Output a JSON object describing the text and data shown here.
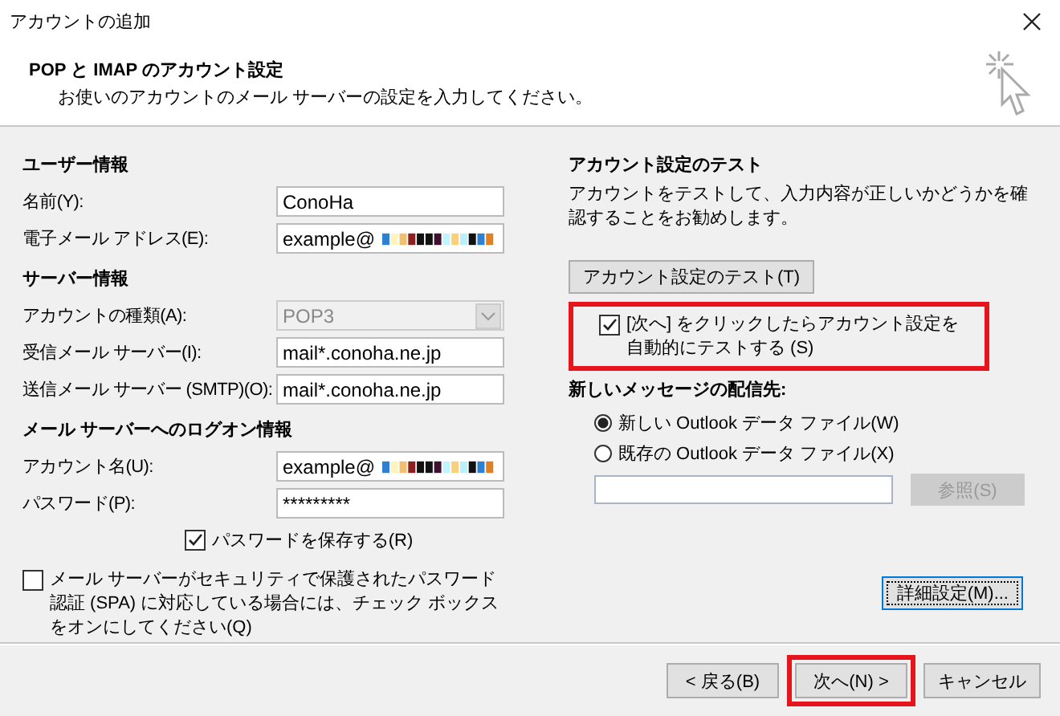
{
  "window": {
    "title": "アカウントの追加"
  },
  "header": {
    "title": "POP と IMAP のアカウント設定",
    "subtitle": "お使いのアカウントのメール サーバーの設定を入力してください。"
  },
  "sections": [
    {
      "heading": "ユーザー情報",
      "fields": [
        {
          "label": "名前(Y):",
          "kind": "text",
          "value": "ConoHa"
        },
        {
          "label": "電子メール アドレス(E):",
          "kind": "redacted",
          "value": "example@"
        }
      ]
    },
    {
      "heading": "サーバー情報",
      "fields": [
        {
          "label": "アカウントの種類(A):",
          "kind": "select",
          "value": "POP3",
          "disabled": true
        },
        {
          "label": "受信メール サーバー(I):",
          "kind": "text",
          "value": "mail*.conoha.ne.jp"
        },
        {
          "label": "送信メール サーバー (SMTP)(O):",
          "kind": "text",
          "value": "mail*.conoha.ne.jp"
        }
      ]
    },
    {
      "heading": "メール サーバーへのログオン情報",
      "fields": [
        {
          "label": "アカウント名(U):",
          "kind": "redacted",
          "value": "example@"
        },
        {
          "label": "パスワード(P):",
          "kind": "text",
          "value": "*********"
        }
      ]
    }
  ],
  "save_password": {
    "label": "パスワードを保存する(R)",
    "checked": true
  },
  "spa": {
    "label": "メール サーバーがセキュリティで保護されたパスワード認証 (SPA) に対応している場合には、チェック ボックスをオンにしてください(Q)",
    "checked": false
  },
  "test": {
    "heading": "アカウント設定のテスト",
    "description": "アカウントをテストして、入力内容が正しいかどうかを確認することをお勧めします。",
    "button": "アカウント設定のテスト(T)",
    "auto_test": {
      "label": "[次へ] をクリックしたらアカウント設定を自動的にテストする (S)",
      "checked": true,
      "highlighted": true
    }
  },
  "delivery": {
    "heading": "新しいメッセージの配信先:",
    "options": [
      {
        "label": "新しい Outlook データ ファイル(W)",
        "selected": true
      },
      {
        "label": "既存の Outlook データ ファイル(X)",
        "selected": false
      }
    ],
    "browse_button": {
      "label": "参照(S)",
      "disabled": true
    }
  },
  "more_settings_button": "詳細設定(M)...",
  "footer_buttons": [
    {
      "label": "< 戻る(B)",
      "highlighted": false
    },
    {
      "label": "次へ(N) >",
      "highlighted": true
    },
    {
      "label": "キャンセル",
      "highlighted": false
    }
  ]
}
